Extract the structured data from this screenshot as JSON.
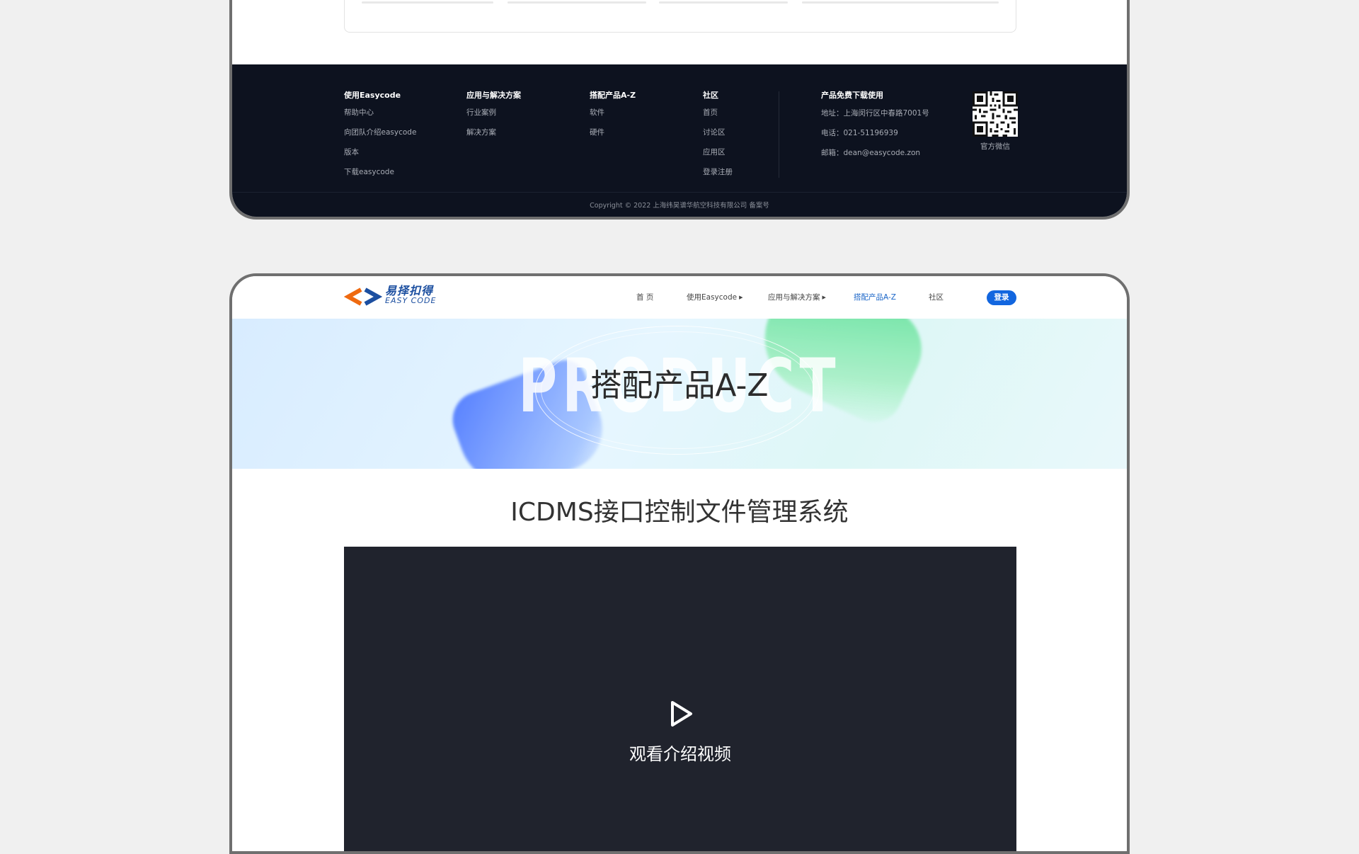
{
  "footer": {
    "columns": [
      {
        "heading": "使用Easycode",
        "links": [
          "帮助中心",
          "向团队介绍easycode",
          "版本",
          "下载easycode"
        ]
      },
      {
        "heading": "应用与解决方案",
        "links": [
          "行业案例",
          "解决方案"
        ]
      },
      {
        "heading": "搭配产品A-Z",
        "links": [
          "软件",
          "硬件"
        ]
      },
      {
        "heading": "社区",
        "links": [
          "首页",
          "讨论区",
          "应用区",
          "登录注册"
        ]
      }
    ],
    "contact": {
      "heading": "产品免费下载使用",
      "address": "地址：上海闵行区中春路7001号",
      "phone": "电话：021-51196939",
      "email": "邮箱：dean@easycode.zon"
    },
    "qr_label": "官方微信",
    "copyright": "Copyright © 2022 上海纬昊谱华航空科技有限公司 备案号"
  },
  "navbar": {
    "logo_cn": "易择扣得",
    "logo_en": "EASY CODE",
    "items": [
      "首 页",
      "使用Easycode",
      "应用与解决方案",
      "搭配产品A-Z",
      "社区"
    ],
    "active_item": "搭配产品A-Z",
    "login_label": "登录",
    "accent_color": "#1266df"
  },
  "hero": {
    "bg_text": "PRODUCT",
    "title": "搭配产品A-Z"
  },
  "page": {
    "heading": "ICDMS接口控制文件管理系统"
  },
  "video": {
    "label": "观看介绍视频",
    "icon": "play-icon"
  }
}
